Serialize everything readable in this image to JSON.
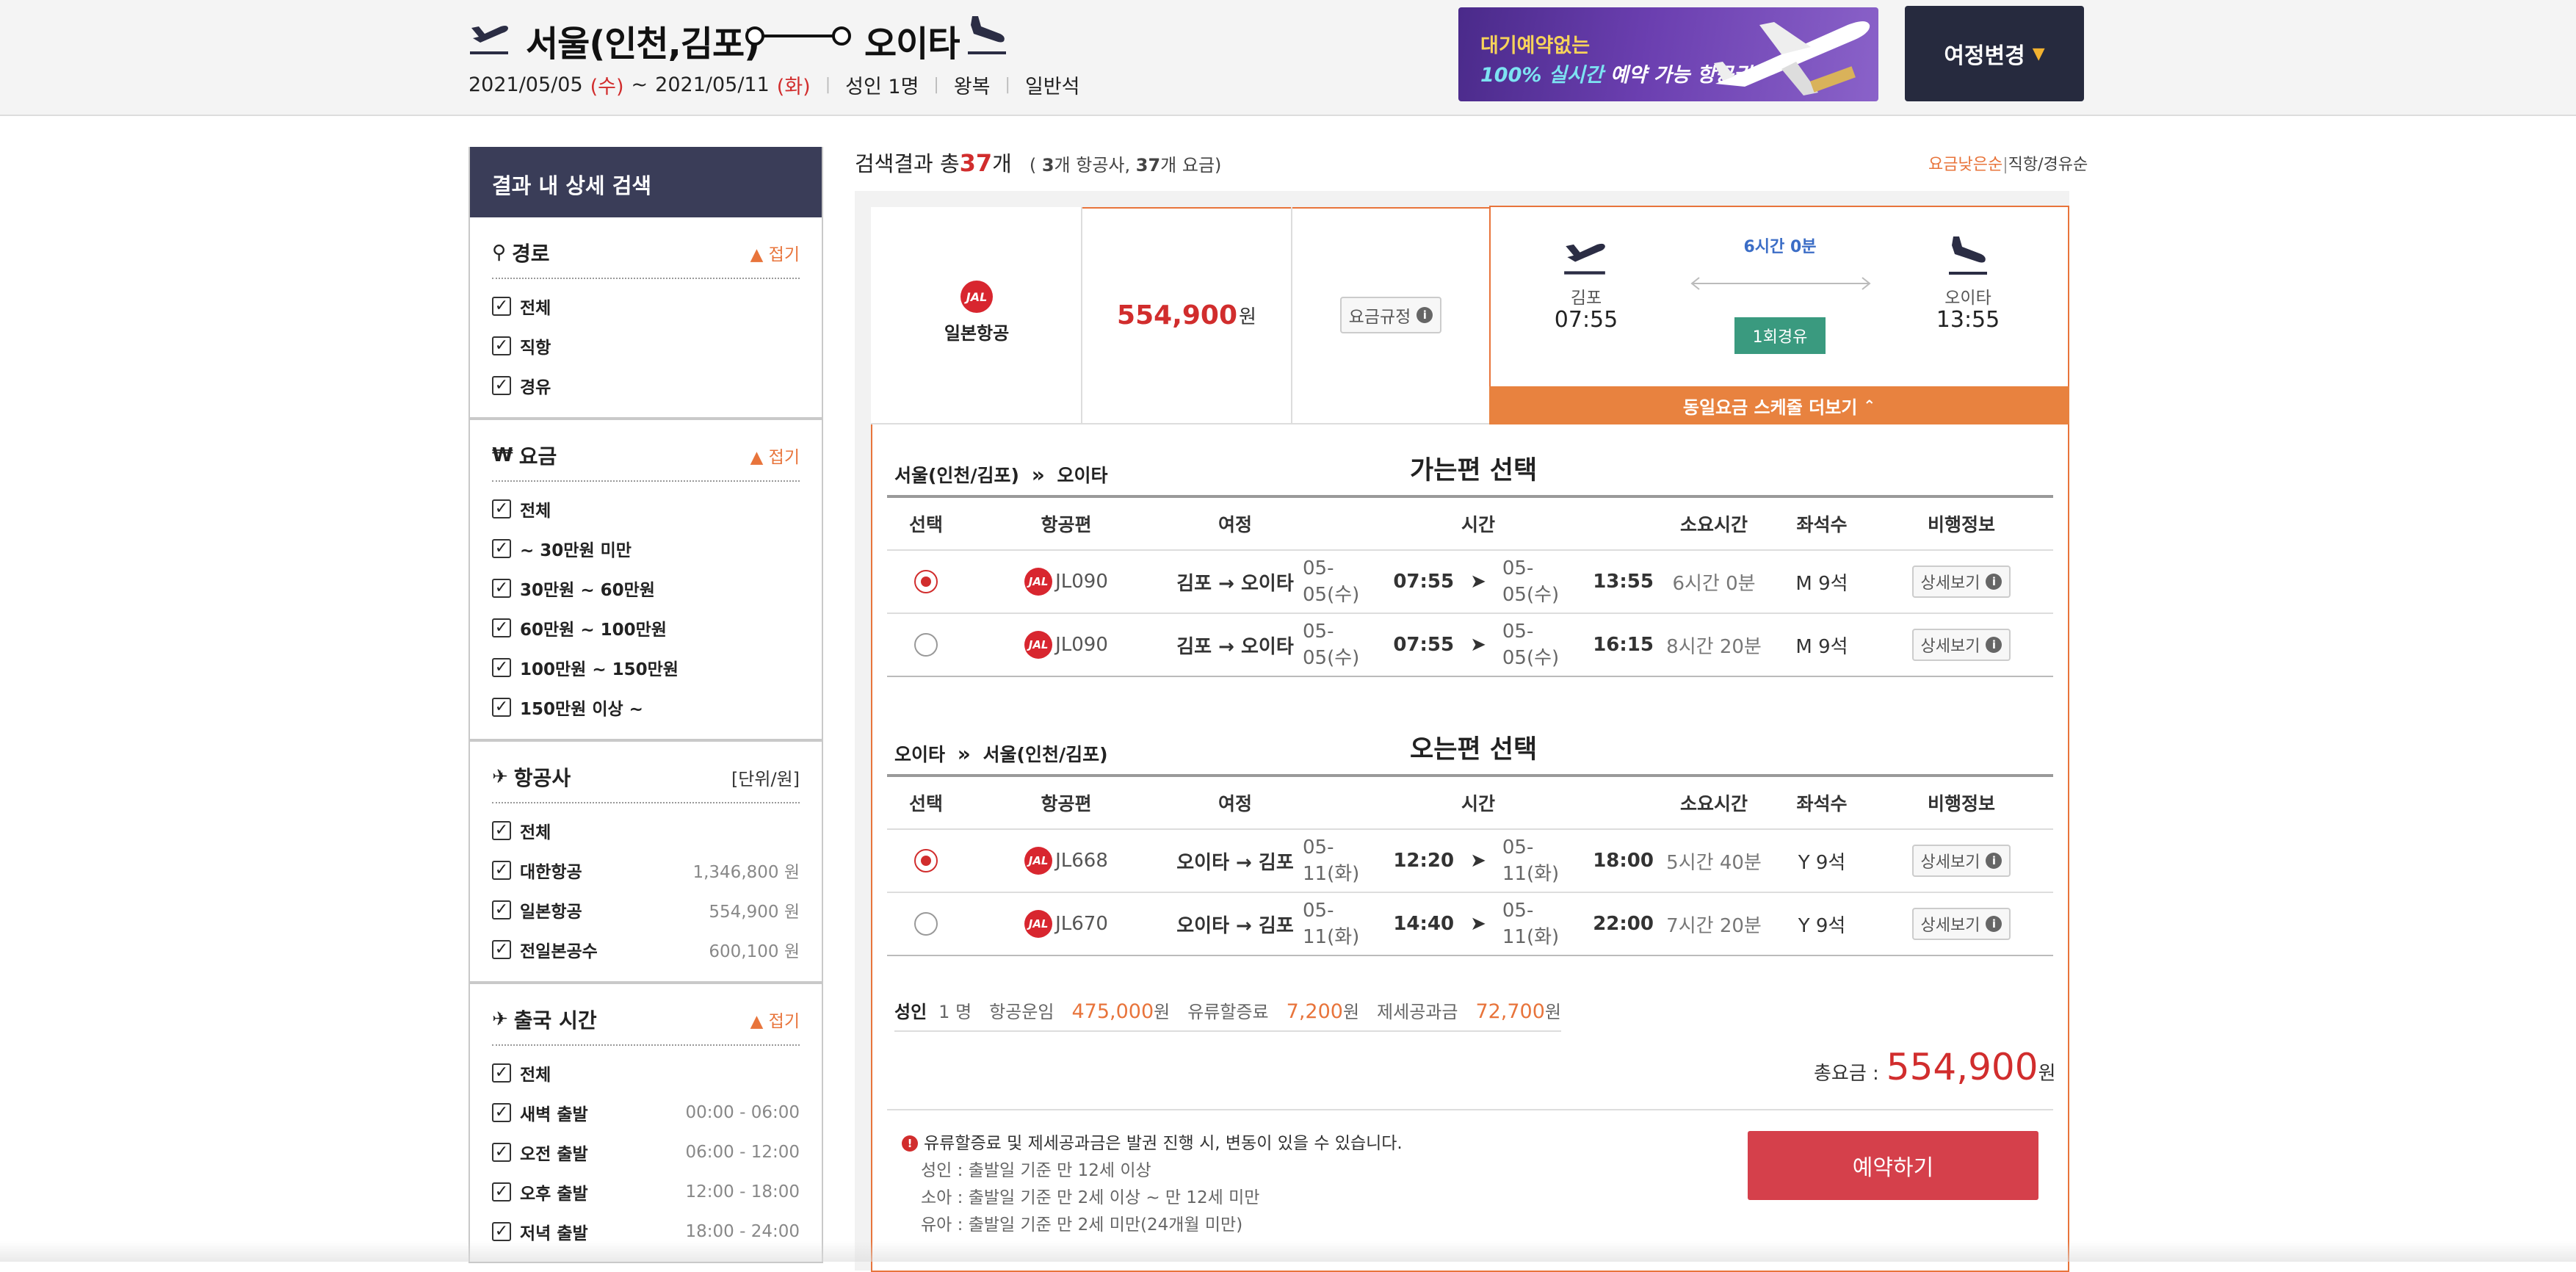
{
  "header": {
    "origin": "서울(인천,김포)",
    "destination": "오이타",
    "date_from": "2021/05/05",
    "date_from_day": "(수)",
    "date_to": "2021/05/11",
    "date_to_day": "(화)",
    "date_sep": "~",
    "passengers": "성인 1명",
    "trip_type": "왕복",
    "cabin": "일반석",
    "banner_line1": "대기예약없는",
    "banner_line2_hl": "100% 실시간",
    "banner_line2": " 예약 가능 항공권!",
    "change_button": "여정변경"
  },
  "sidebar": {
    "title": "결과 내 상세 검색",
    "fold_label": "접기",
    "sections": [
      {
        "title": "경로",
        "icon": "route-icon",
        "right": "fold",
        "items": [
          {
            "label": "전체"
          },
          {
            "label": "직항"
          },
          {
            "label": "경유"
          }
        ]
      },
      {
        "title": "요금",
        "icon": "won-icon",
        "right": "fold",
        "items": [
          {
            "label": "전체"
          },
          {
            "label": "~ 30만원 미만"
          },
          {
            "label": "30만원 ~ 60만원"
          },
          {
            "label": "60만원 ~ 100만원"
          },
          {
            "label": "100만원 ~ 150만원"
          },
          {
            "label": "150만원 이상 ~"
          }
        ]
      },
      {
        "title": "항공사",
        "icon": "airplane-icon",
        "right": "[단위/원]",
        "items": [
          {
            "label": "전체",
            "value": ""
          },
          {
            "label": "대한항공",
            "value": "1,346,800 원"
          },
          {
            "label": "일본항공",
            "value": "554,900 원"
          },
          {
            "label": "전일본공수",
            "value": "600,100 원"
          }
        ]
      },
      {
        "title": "출국 시간",
        "icon": "departure-icon",
        "right": "fold",
        "items": [
          {
            "label": "전체",
            "value": ""
          },
          {
            "label": "새벽 출발",
            "value": "00:00 - 06:00"
          },
          {
            "label": "오전 출발",
            "value": "06:00 - 12:00"
          },
          {
            "label": "오후 출발",
            "value": "12:00 - 18:00"
          },
          {
            "label": "저녁 출발",
            "value": "18:00 - 24:00"
          }
        ]
      }
    ]
  },
  "results": {
    "prefix": "검색결과 총 ",
    "count": "37",
    "suffix": "개",
    "sub_open": "( ",
    "airlines": "3",
    "airlines_label": "개 항공사, ",
    "fares": "37",
    "fares_label": "개 요금)",
    "sort_active": "요금낮은순",
    "sort_sep": "|",
    "sort_other": "직항/경유순"
  },
  "card": {
    "airline": "일본항공",
    "price": "554,900",
    "price_unit": "원",
    "rule_button": "요금규정",
    "dep_airport": "김포",
    "dep_time": "07:55",
    "arr_airport": "오이타",
    "arr_time": "13:55",
    "duration": "6시간 0분",
    "stops": "1회경유",
    "more_schedules": "동일요금 스케줄 더보기"
  },
  "outbound": {
    "from": "서울(인천/김포)",
    "to": "오이타",
    "title": "가는편 선택",
    "headers": [
      "선택",
      "항공편",
      "여정",
      "시간",
      "소요시간",
      "좌석수",
      "비행정보"
    ],
    "rows": [
      {
        "selected": true,
        "flight": "JL090",
        "route": "김포 → 오이타",
        "dep_date": "05-05(수)",
        "dep_time": "07:55",
        "arr_date": "05-05(수)",
        "arr_time": "13:55",
        "duration": "6시간 0분",
        "seats": "M 9석",
        "detail": "상세보기"
      },
      {
        "selected": false,
        "flight": "JL090",
        "route": "김포 → 오이타",
        "dep_date": "05-05(수)",
        "dep_time": "07:55",
        "arr_date": "05-05(수)",
        "arr_time": "16:15",
        "duration": "8시간 20분",
        "seats": "M 9석",
        "detail": "상세보기"
      }
    ]
  },
  "inbound": {
    "from": "오이타",
    "to": "서울(인천/김포)",
    "title": "오는편 선택",
    "headers": [
      "선택",
      "항공편",
      "여정",
      "시간",
      "소요시간",
      "좌석수",
      "비행정보"
    ],
    "rows": [
      {
        "selected": true,
        "flight": "JL668",
        "route": "오이타 → 김포",
        "dep_date": "05-11(화)",
        "dep_time": "12:20",
        "arr_date": "05-11(화)",
        "arr_time": "18:00",
        "duration": "5시간 40분",
        "seats": "Y 9석",
        "detail": "상세보기"
      },
      {
        "selected": false,
        "flight": "JL670",
        "route": "오이타 → 김포",
        "dep_date": "05-11(화)",
        "dep_time": "14:40",
        "arr_date": "05-11(화)",
        "arr_time": "22:00",
        "duration": "7시간 20분",
        "seats": "Y 9석",
        "detail": "상세보기"
      }
    ]
  },
  "fare": {
    "pax_label": "성인",
    "pax_count": "1 명",
    "base_label": "항공운임",
    "base": "475,000",
    "fuel_label": "유류할증료",
    "fuel": "7,200",
    "tax_label": "제세공과금",
    "tax": "72,700",
    "unit": "원",
    "total_label": "총요금 :",
    "total": "554,900"
  },
  "notes": {
    "warning": "유류할증료 및 제세공과금은 발권 진행 시, 변동이 있을 수 있습니다.",
    "adult": "성인 : 출발일 기준 만 12세 이상",
    "child": "소아 : 출발일 기준 만 2세 이상 ~ 만 12세 미만",
    "infant": "유아 : 출발일 기준 만 2세 미만(24개월 미만)"
  },
  "book_button": "예약하기",
  "colors": {
    "accent": "#e8743b",
    "red": "#d12d2d",
    "navy": "#3a3d58",
    "green": "#3a9a7f",
    "book": "#d5404b"
  }
}
